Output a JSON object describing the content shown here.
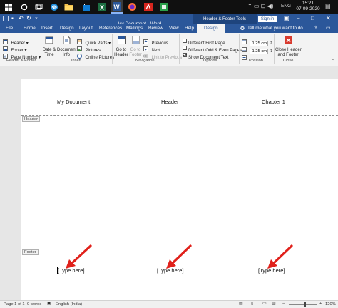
{
  "taskbar": {
    "time": "15:21",
    "date": "07-09-2020",
    "lang": "ENG"
  },
  "titlebar": {
    "title": "My Document  -  Word",
    "contextual_tools": "Header & Footer Tools",
    "signin": "Sign in"
  },
  "tabs": [
    "File",
    "Home",
    "Insert",
    "Design",
    "Layout",
    "References",
    "Mailings",
    "Review",
    "View",
    "Help"
  ],
  "active_tab": "Design",
  "tell_me": "Tell me what you want to do",
  "ribbon": {
    "header_footer_group": {
      "header": "Header",
      "footer": "Footer",
      "page_number": "Page Number",
      "label": "Header & Footer"
    },
    "insert_group": {
      "date_time_line1": "Date &",
      "date_time_line2": "Time",
      "doc_info_line1": "Document",
      "doc_info_line2": "Info",
      "quick_parts": "Quick Parts",
      "pictures": "Pictures",
      "online_pictures": "Online Pictures",
      "label": "Insert"
    },
    "navigation_group": {
      "go_to_header_line1": "Go to",
      "go_to_header_line2": "Header",
      "go_to_footer_line1": "Go to",
      "go_to_footer_line2": "Footer",
      "previous": "Previous",
      "next": "Next",
      "link_to_previous": "Link to Previous",
      "label": "Navigation"
    },
    "options_group": {
      "different_first_page": "Different First Page",
      "different_odd_even": "Different Odd & Even Pages",
      "show_document_text": "Show Document Text",
      "label": "Options"
    },
    "position_group": {
      "header_pos": "1.25 cm",
      "footer_pos": "1.25 cm",
      "label": "Position"
    },
    "close_group": {
      "close_line1": "Close Header",
      "close_line2": "and Footer",
      "label": "Close"
    }
  },
  "document": {
    "header_left": "My Document",
    "header_center": "Header",
    "header_right": "Chapter 1",
    "header_tag": "Header",
    "footer_tag": "Footer",
    "footer_left": "[Type here]",
    "footer_center": "[Type here]",
    "footer_right": "[Type here]"
  },
  "statusbar": {
    "page": "Page 1 of 1",
    "words": "0 words",
    "language": "English (India)",
    "zoom": "120%"
  },
  "colors": {
    "word_blue": "#2b579a",
    "arrow_red": "#e0211b"
  }
}
